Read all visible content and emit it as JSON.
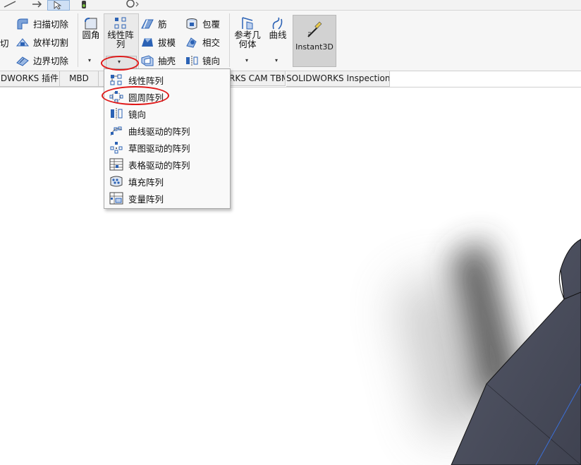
{
  "ribbon": {
    "left_partial": {
      "label": "切"
    },
    "col1": [
      {
        "label": "扫描切除",
        "icon": "swept-cut-icon"
      },
      {
        "label": "放样切割",
        "icon": "lofted-cut-icon"
      },
      {
        "label": "边界切除",
        "icon": "boundary-cut-icon"
      }
    ],
    "fillet": {
      "label": "圆角",
      "icon": "fillet-icon"
    },
    "linear_pattern": {
      "label_line1": "线性阵",
      "label_line2": "列",
      "icon": "linear-pattern-icon"
    },
    "col3": [
      {
        "label": "筋",
        "icon": "rib-icon"
      },
      {
        "label": "拔模",
        "icon": "draft-icon"
      },
      {
        "label": "抽壳",
        "icon": "shell-icon"
      }
    ],
    "col4": [
      {
        "label": "包覆",
        "icon": "wrap-icon"
      },
      {
        "label": "相交",
        "icon": "intersect-icon"
      },
      {
        "label": "镜向",
        "icon": "mirror-icon"
      }
    ],
    "ref_geometry": {
      "label_line1": "参考几",
      "label_line2": "何体",
      "icon": "reference-geometry-icon"
    },
    "curves": {
      "label": "曲线",
      "icon": "curves-icon"
    },
    "instant3d": {
      "label": "Instant3D",
      "icon": "instant3d-icon"
    },
    "dropdown_glyph": "▾"
  },
  "tabs": [
    {
      "label": "DWORKS 插件"
    },
    {
      "label": "MBD"
    },
    {
      "label": "RKS CAM TBM"
    },
    {
      "label": "SOLIDWORKS Inspection"
    }
  ],
  "pattern_menu": {
    "items": [
      {
        "label": "线性阵列",
        "icon": "linear-pattern-icon"
      },
      {
        "label": "圆周阵列",
        "icon": "circular-pattern-icon",
        "highlighted": true
      },
      {
        "label": "镜向",
        "icon": "mirror-icon"
      },
      {
        "label": "曲线驱动的阵列",
        "icon": "curve-driven-pattern-icon"
      },
      {
        "label": "草图驱动的阵列",
        "icon": "sketch-driven-pattern-icon"
      },
      {
        "label": "表格驱动的阵列",
        "icon": "table-driven-pattern-icon"
      },
      {
        "label": "填充阵列",
        "icon": "fill-pattern-icon"
      },
      {
        "label": "变量阵列",
        "icon": "variable-pattern-icon"
      }
    ]
  },
  "colors": {
    "annotation": "#e01818",
    "model_body": "#4a4d5c",
    "icon_blue": "#2b62b5"
  }
}
